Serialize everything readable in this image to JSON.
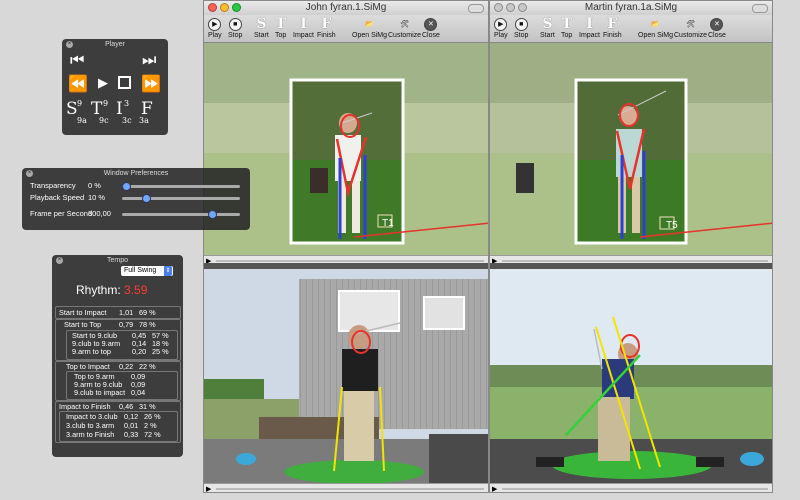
{
  "window_left": {
    "title": "John fyran.1.SiMg",
    "toolbar": [
      "Play",
      "Stop",
      "Start",
      "Top",
      "Impact",
      "Finish",
      "Open SiMg",
      "Customize",
      "Close"
    ],
    "letters": [
      "S",
      "T",
      "I",
      "F"
    ]
  },
  "window_right": {
    "title": "Martin fyran.1a.SiMg",
    "toolbar": [
      "Play",
      "Stop",
      "Start",
      "Top",
      "Impact",
      "Finish",
      "Open SiMg",
      "Customize",
      "Close"
    ],
    "letters": [
      "S",
      "T",
      "I",
      "F"
    ]
  },
  "bottom_menu": [
    "Play",
    "Stop",
    "Start",
    "Top",
    "Impact",
    "Finish",
    "Open SiMg",
    "Customize",
    "Close"
  ],
  "video_tags": {
    "left": "T1",
    "right": "T5"
  },
  "player": {
    "title": "Player",
    "markers": [
      {
        "letter": "S",
        "sup": "9",
        "sub": "9a"
      },
      {
        "letter": "T",
        "sup": "9",
        "sub": "9c"
      },
      {
        "letter": "I",
        "sup": "3",
        "sub": "3c"
      },
      {
        "letter": "F",
        "sup": "",
        "sub": "3a"
      }
    ]
  },
  "window_preferences": {
    "title": "Window Preferences",
    "rows": [
      {
        "label": "Transparency",
        "value": "0 %",
        "level": 0.0
      },
      {
        "label": "Playback Speed",
        "value": "10 %",
        "level": 0.1
      },
      {
        "label": "Frame per Second",
        "value": "300,00",
        "level": 0.75
      }
    ]
  },
  "tempo": {
    "title": "Tempo",
    "swing_select": "Full Swing",
    "rhythm_label": "Rhythm:",
    "rhythm_value": "3.59",
    "groups": [
      {
        "rows": [
          {
            "label": "Start to Impact",
            "t": "1,01",
            "p": "69 %"
          }
        ]
      },
      {
        "rows": [
          {
            "label": "Start to Top",
            "t": "0,79",
            "p": "78 %"
          }
        ],
        "sub": [
          {
            "label": "Start to 9.club",
            "t": "0,45",
            "p": "57 %"
          },
          {
            "label": "9.club to 9.arm",
            "t": "0,14",
            "p": "18 %"
          },
          {
            "label": "9.arm to top",
            "t": "0,20",
            "p": "25 %"
          }
        ]
      },
      {
        "rows": [
          {
            "label": "Top to Impact",
            "t": "0,22",
            "p": "22 %"
          }
        ],
        "sub": [
          {
            "label": "Top to 9.arm",
            "t": "0,09",
            "p": ""
          },
          {
            "label": "9.arm to 9.club",
            "t": "0,09",
            "p": ""
          },
          {
            "label": "9.club to impact",
            "t": "0,04",
            "p": ""
          }
        ]
      },
      {
        "rows": [
          {
            "label": "Impact to Finish",
            "t": "0,46",
            "p": "31 %"
          }
        ],
        "sub": [
          {
            "label": "Impact to 3.club",
            "t": "0,12",
            "p": "26 %"
          },
          {
            "label": "3.club to 3.arm",
            "t": "0,01",
            "p": "2 %"
          },
          {
            "label": "3.arm to Finish",
            "t": "0,33",
            "p": "72 %"
          }
        ]
      }
    ]
  },
  "colors": {
    "rhythm": "#ff3b30",
    "frame": "#ffffff",
    "overlay_red": "#e8322a",
    "overlay_blue": "#2e3fd6",
    "overlay_yellow": "#f2e400",
    "overlay_green": "#35d13a"
  }
}
